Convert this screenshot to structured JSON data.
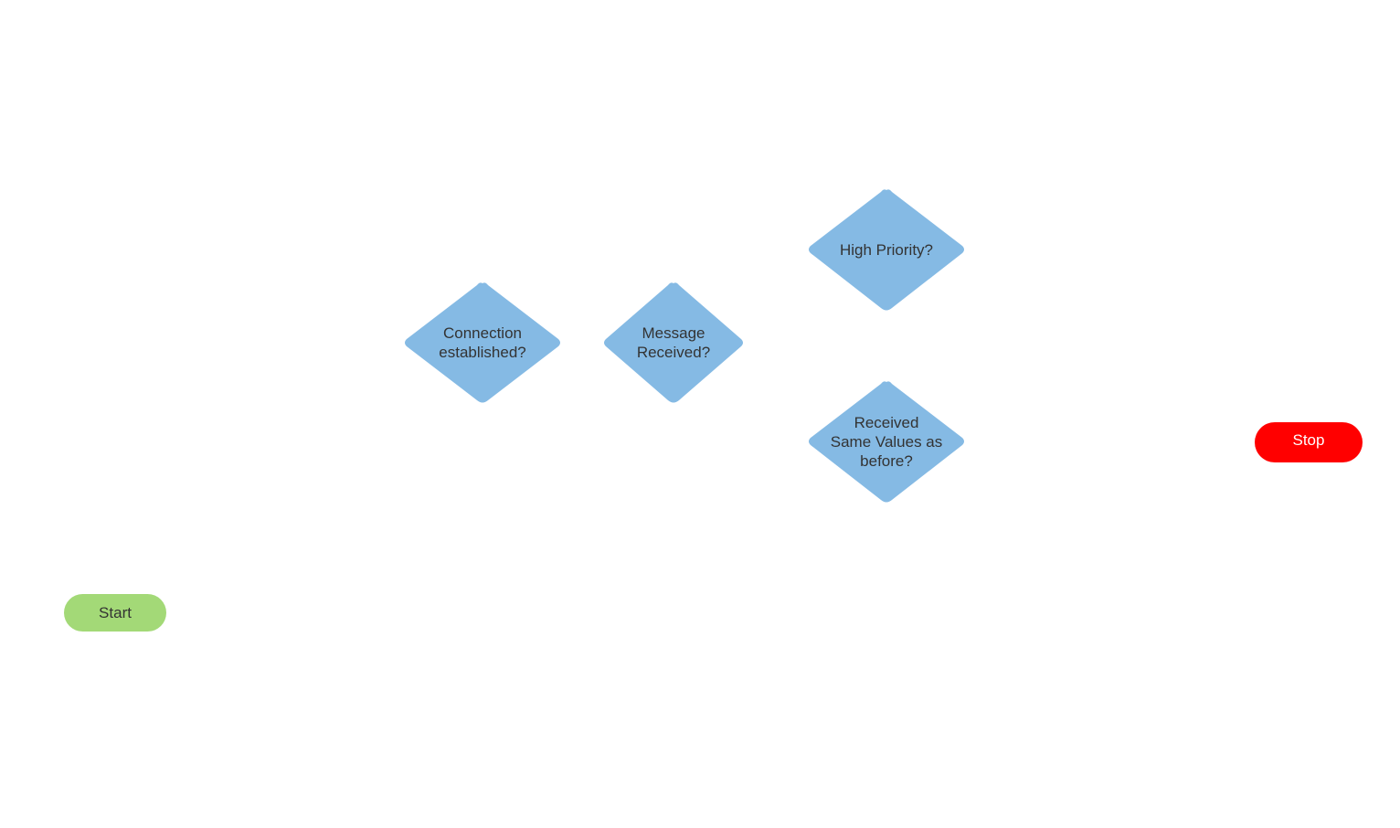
{
  "diagram": {
    "colors": {
      "decision_fill": "#85bae4",
      "start_fill": "#a3d977",
      "stop_fill": "#ff0000",
      "text_dark": "#333333",
      "text_light": "#ffffff"
    },
    "nodes": {
      "start": {
        "type": "terminal",
        "label": "Start"
      },
      "connection": {
        "type": "decision",
        "label": "Connection\nestablished?"
      },
      "message": {
        "type": "decision",
        "label": "Message\nReceived?"
      },
      "priority": {
        "type": "decision",
        "label": "High Priority?"
      },
      "same_values": {
        "type": "decision",
        "label": "Received\nSame Values  as\nbefore?"
      },
      "stop": {
        "type": "terminal",
        "label": "Stop"
      }
    }
  }
}
